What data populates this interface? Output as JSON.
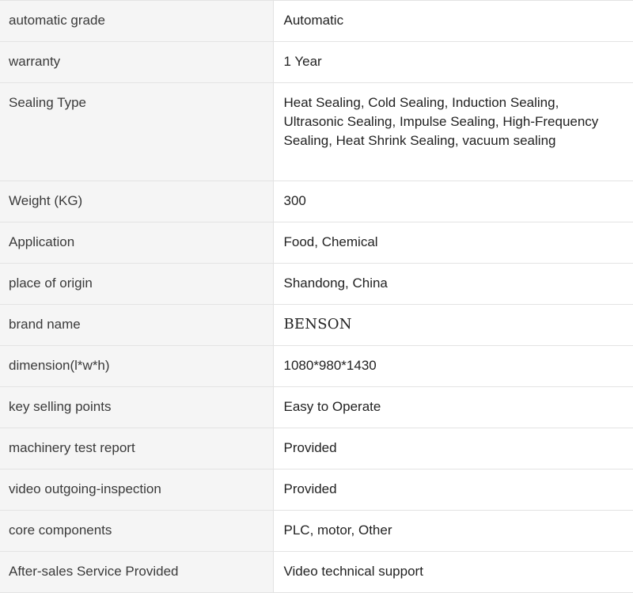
{
  "rows": [
    {
      "key": "automatic grade",
      "value": "Automatic"
    },
    {
      "key": "warranty",
      "value": "1 Year"
    },
    {
      "key": "Sealing Type",
      "value": "Heat Sealing, Cold Sealing, Induction Sealing, Ultrasonic Sealing, Impulse Sealing, High-Frequency Sealing, Heat Shrink Sealing, vacuum sealing"
    },
    {
      "key": "Weight (KG)",
      "value": "300"
    },
    {
      "key": "Application",
      "value": "Food, Chemical"
    },
    {
      "key": "place of origin",
      "value": "Shandong, China"
    },
    {
      "key": "brand name",
      "value": "BENSON"
    },
    {
      "key": "dimension(l*w*h)",
      "value": "1080*980*1430"
    },
    {
      "key": "key selling points",
      "value": "Easy to Operate"
    },
    {
      "key": "machinery test report",
      "value": "Provided"
    },
    {
      "key": "video outgoing-inspection",
      "value": "Provided"
    },
    {
      "key": "core components",
      "value": "PLC, motor, Other"
    },
    {
      "key": "After-sales Service Provided",
      "value": "Video technical support"
    }
  ]
}
